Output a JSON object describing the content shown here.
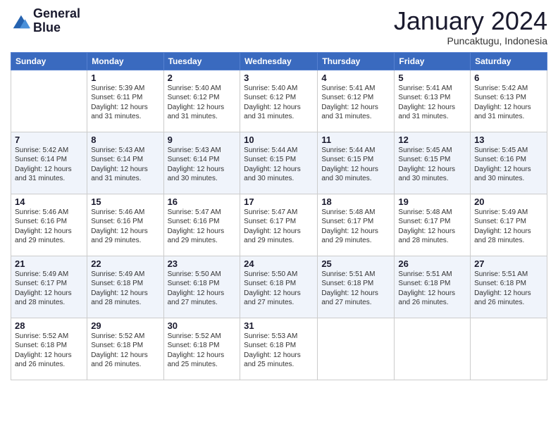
{
  "logo": {
    "line1": "General",
    "line2": "Blue"
  },
  "title": "January 2024",
  "subtitle": "Puncaktugu, Indonesia",
  "days_header": [
    "Sunday",
    "Monday",
    "Tuesday",
    "Wednesday",
    "Thursday",
    "Friday",
    "Saturday"
  ],
  "weeks": [
    [
      {
        "num": "",
        "sunrise": "",
        "sunset": "",
        "daylight": ""
      },
      {
        "num": "1",
        "sunrise": "Sunrise: 5:39 AM",
        "sunset": "Sunset: 6:11 PM",
        "daylight": "Daylight: 12 hours and 31 minutes."
      },
      {
        "num": "2",
        "sunrise": "Sunrise: 5:40 AM",
        "sunset": "Sunset: 6:12 PM",
        "daylight": "Daylight: 12 hours and 31 minutes."
      },
      {
        "num": "3",
        "sunrise": "Sunrise: 5:40 AM",
        "sunset": "Sunset: 6:12 PM",
        "daylight": "Daylight: 12 hours and 31 minutes."
      },
      {
        "num": "4",
        "sunrise": "Sunrise: 5:41 AM",
        "sunset": "Sunset: 6:12 PM",
        "daylight": "Daylight: 12 hours and 31 minutes."
      },
      {
        "num": "5",
        "sunrise": "Sunrise: 5:41 AM",
        "sunset": "Sunset: 6:13 PM",
        "daylight": "Daylight: 12 hours and 31 minutes."
      },
      {
        "num": "6",
        "sunrise": "Sunrise: 5:42 AM",
        "sunset": "Sunset: 6:13 PM",
        "daylight": "Daylight: 12 hours and 31 minutes."
      }
    ],
    [
      {
        "num": "7",
        "sunrise": "Sunrise: 5:42 AM",
        "sunset": "Sunset: 6:14 PM",
        "daylight": "Daylight: 12 hours and 31 minutes."
      },
      {
        "num": "8",
        "sunrise": "Sunrise: 5:43 AM",
        "sunset": "Sunset: 6:14 PM",
        "daylight": "Daylight: 12 hours and 31 minutes."
      },
      {
        "num": "9",
        "sunrise": "Sunrise: 5:43 AM",
        "sunset": "Sunset: 6:14 PM",
        "daylight": "Daylight: 12 hours and 30 minutes."
      },
      {
        "num": "10",
        "sunrise": "Sunrise: 5:44 AM",
        "sunset": "Sunset: 6:15 PM",
        "daylight": "Daylight: 12 hours and 30 minutes."
      },
      {
        "num": "11",
        "sunrise": "Sunrise: 5:44 AM",
        "sunset": "Sunset: 6:15 PM",
        "daylight": "Daylight: 12 hours and 30 minutes."
      },
      {
        "num": "12",
        "sunrise": "Sunrise: 5:45 AM",
        "sunset": "Sunset: 6:15 PM",
        "daylight": "Daylight: 12 hours and 30 minutes."
      },
      {
        "num": "13",
        "sunrise": "Sunrise: 5:45 AM",
        "sunset": "Sunset: 6:16 PM",
        "daylight": "Daylight: 12 hours and 30 minutes."
      }
    ],
    [
      {
        "num": "14",
        "sunrise": "Sunrise: 5:46 AM",
        "sunset": "Sunset: 6:16 PM",
        "daylight": "Daylight: 12 hours and 29 minutes."
      },
      {
        "num": "15",
        "sunrise": "Sunrise: 5:46 AM",
        "sunset": "Sunset: 6:16 PM",
        "daylight": "Daylight: 12 hours and 29 minutes."
      },
      {
        "num": "16",
        "sunrise": "Sunrise: 5:47 AM",
        "sunset": "Sunset: 6:16 PM",
        "daylight": "Daylight: 12 hours and 29 minutes."
      },
      {
        "num": "17",
        "sunrise": "Sunrise: 5:47 AM",
        "sunset": "Sunset: 6:17 PM",
        "daylight": "Daylight: 12 hours and 29 minutes."
      },
      {
        "num": "18",
        "sunrise": "Sunrise: 5:48 AM",
        "sunset": "Sunset: 6:17 PM",
        "daylight": "Daylight: 12 hours and 29 minutes."
      },
      {
        "num": "19",
        "sunrise": "Sunrise: 5:48 AM",
        "sunset": "Sunset: 6:17 PM",
        "daylight": "Daylight: 12 hours and 28 minutes."
      },
      {
        "num": "20",
        "sunrise": "Sunrise: 5:49 AM",
        "sunset": "Sunset: 6:17 PM",
        "daylight": "Daylight: 12 hours and 28 minutes."
      }
    ],
    [
      {
        "num": "21",
        "sunrise": "Sunrise: 5:49 AM",
        "sunset": "Sunset: 6:17 PM",
        "daylight": "Daylight: 12 hours and 28 minutes."
      },
      {
        "num": "22",
        "sunrise": "Sunrise: 5:49 AM",
        "sunset": "Sunset: 6:18 PM",
        "daylight": "Daylight: 12 hours and 28 minutes."
      },
      {
        "num": "23",
        "sunrise": "Sunrise: 5:50 AM",
        "sunset": "Sunset: 6:18 PM",
        "daylight": "Daylight: 12 hours and 27 minutes."
      },
      {
        "num": "24",
        "sunrise": "Sunrise: 5:50 AM",
        "sunset": "Sunset: 6:18 PM",
        "daylight": "Daylight: 12 hours and 27 minutes."
      },
      {
        "num": "25",
        "sunrise": "Sunrise: 5:51 AM",
        "sunset": "Sunset: 6:18 PM",
        "daylight": "Daylight: 12 hours and 27 minutes."
      },
      {
        "num": "26",
        "sunrise": "Sunrise: 5:51 AM",
        "sunset": "Sunset: 6:18 PM",
        "daylight": "Daylight: 12 hours and 26 minutes."
      },
      {
        "num": "27",
        "sunrise": "Sunrise: 5:51 AM",
        "sunset": "Sunset: 6:18 PM",
        "daylight": "Daylight: 12 hours and 26 minutes."
      }
    ],
    [
      {
        "num": "28",
        "sunrise": "Sunrise: 5:52 AM",
        "sunset": "Sunset: 6:18 PM",
        "daylight": "Daylight: 12 hours and 26 minutes."
      },
      {
        "num": "29",
        "sunrise": "Sunrise: 5:52 AM",
        "sunset": "Sunset: 6:18 PM",
        "daylight": "Daylight: 12 hours and 26 minutes."
      },
      {
        "num": "30",
        "sunrise": "Sunrise: 5:52 AM",
        "sunset": "Sunset: 6:18 PM",
        "daylight": "Daylight: 12 hours and 25 minutes."
      },
      {
        "num": "31",
        "sunrise": "Sunrise: 5:53 AM",
        "sunset": "Sunset: 6:18 PM",
        "daylight": "Daylight: 12 hours and 25 minutes."
      },
      {
        "num": "",
        "sunrise": "",
        "sunset": "",
        "daylight": ""
      },
      {
        "num": "",
        "sunrise": "",
        "sunset": "",
        "daylight": ""
      },
      {
        "num": "",
        "sunrise": "",
        "sunset": "",
        "daylight": ""
      }
    ]
  ]
}
